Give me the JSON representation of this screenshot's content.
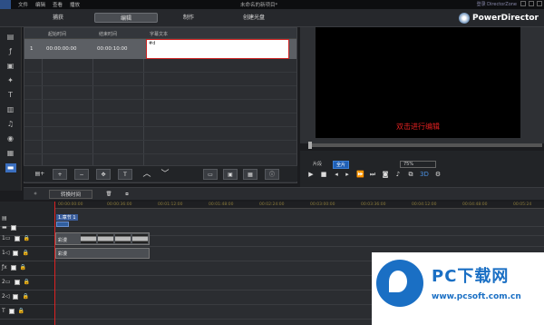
{
  "menubar": {
    "items": [
      "文件",
      "编辑",
      "查看",
      "播放"
    ],
    "project_title": "未命名的新项目*",
    "director_zone": "登录 DirectorZone"
  },
  "tabs": [
    "捕获",
    "编辑",
    "制作",
    "创建光盘"
  ],
  "brand": {
    "name": "PowerDirector"
  },
  "subtitle_table": {
    "headers": [
      "起始时间",
      "结束时间",
      "字幕文本"
    ],
    "rows": [
      {
        "index": "1",
        "start": "00:00:00:00",
        "end": "00:00:10:00",
        "text": "#d"
      }
    ]
  },
  "preview": {
    "hint": "双击进行编辑",
    "mode_clip": "片段",
    "mode_movie": "全片",
    "zoom": "75%"
  },
  "midbar": {
    "keyframe_label": "转换时间"
  },
  "timeline": {
    "ruler_ticks": [
      "00:00:00:00",
      "00:00:36:00",
      "00:01:12:00",
      "00:01:48:00",
      "00:02:24:00",
      "00:03:00:00",
      "00:03:36:00",
      "00:04:12:00",
      "00:04:48:00",
      "00:05:24"
    ],
    "chapter_label": "1.章节 1",
    "video_clip_label": "彩漫",
    "audio_clip_label": "彩漫"
  },
  "watermark": {
    "title": "PC下载网",
    "url": "www.pcsoft.com.cn"
  },
  "colors": {
    "accent": "#1f5fb5",
    "playhead": "#dd2222",
    "hint": "#e02020",
    "watermark": "#1a6fc4"
  }
}
